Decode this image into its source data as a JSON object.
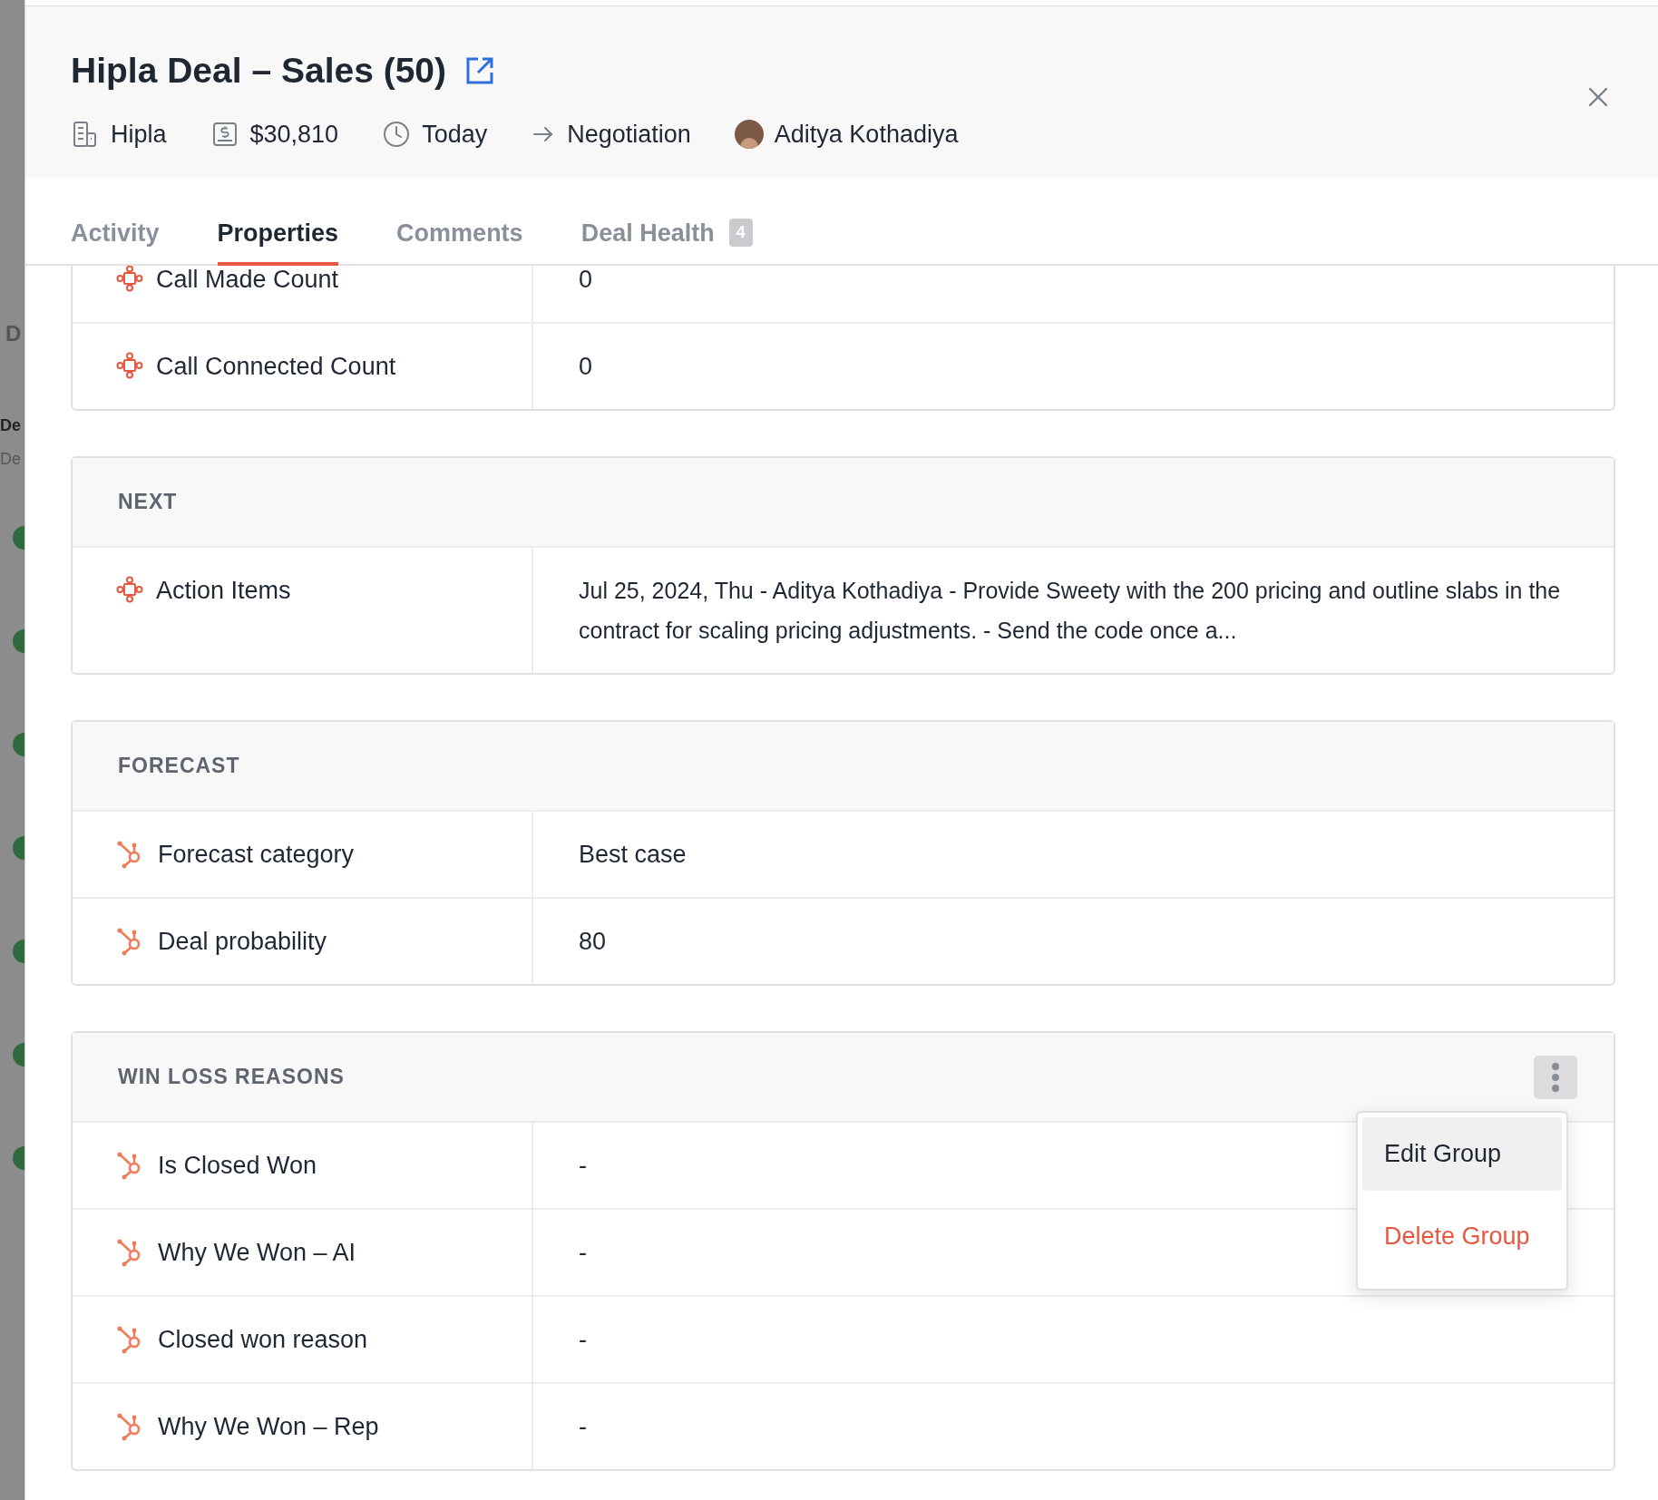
{
  "backdrop": {
    "texts": [
      "D",
      "De",
      "De"
    ]
  },
  "header": {
    "title": "Hipla Deal – Sales (50)",
    "meta": [
      {
        "kind": "company",
        "text": "Hipla"
      },
      {
        "kind": "amount",
        "text": "$30,810"
      },
      {
        "kind": "date",
        "text": "Today"
      },
      {
        "kind": "stage",
        "text": "Negotiation"
      },
      {
        "kind": "owner",
        "text": "Aditya Kothadiya"
      }
    ]
  },
  "tabs": [
    {
      "label": "Activity",
      "selected": false
    },
    {
      "label": "Properties",
      "selected": true
    },
    {
      "label": "Comments",
      "selected": false
    },
    {
      "label": "Deal Health",
      "selected": false,
      "badge": "4"
    }
  ],
  "groups": [
    {
      "rows": [
        {
          "kind": "node",
          "label": "Call Made Count",
          "value": "0"
        },
        {
          "kind": "node",
          "label": "Call Connected Count",
          "value": "0"
        }
      ]
    },
    {
      "title": "NEXT",
      "rows": [
        {
          "kind": "node",
          "label": "Action Items",
          "value": "Jul 25, 2024, Thu - Aditya Kothadiya - Provide Sweety with the 200 pricing and outline slabs in the contract for scaling pricing adjustments. - Send the code once a..."
        }
      ]
    },
    {
      "title": "FORECAST",
      "rows": [
        {
          "kind": "sprocket",
          "label": "Forecast category",
          "value": "Best case"
        },
        {
          "kind": "sprocket",
          "label": "Deal probability",
          "value": "80"
        }
      ]
    },
    {
      "title": "WIN LOSS REASONS",
      "menu": [
        {
          "label": "Edit Group",
          "kind": "normal",
          "selected": true
        },
        {
          "label": "Delete Group",
          "kind": "danger",
          "selected": false
        }
      ],
      "rows": [
        {
          "kind": "sprocket",
          "label": "Is Closed Won",
          "value": "-"
        },
        {
          "kind": "sprocket",
          "label": "Why We Won – AI",
          "value": "-"
        },
        {
          "kind": "sprocket",
          "label": "Closed won reason",
          "value": "-"
        },
        {
          "kind": "sprocket",
          "label": "Why We Won – Rep",
          "value": "-"
        }
      ]
    }
  ]
}
